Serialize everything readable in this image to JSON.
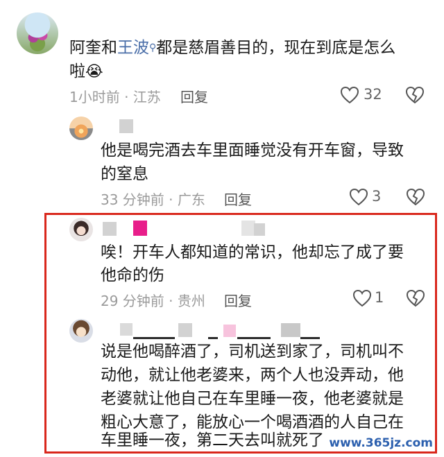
{
  "comments": [
    {
      "text_lines": [
        "阿奎和",
        "王波",
        "都是慈眉善目的，现在到底是怎么",
        "啦"
      ],
      "emoji": "😭",
      "meta": "1小时前 · 江苏",
      "reply": "回复",
      "likes": "32"
    },
    {
      "text_lines": [
        "他是喝完酒去车里面睡觉没有开车窗，导致",
        "的窒息"
      ],
      "meta": "33 分钟前 · 广东",
      "reply": "回复",
      "likes": "3"
    },
    {
      "text_lines": [
        "唉！开车人都知道的常识，他却忘了成了要",
        "他命的伤"
      ],
      "meta": "29 分钟前 · 贵州",
      "reply": "回复",
      "likes": "1"
    },
    {
      "text_lines": [
        "说是他喝醉酒了，司机送到家了，司机叫不",
        "动他，就让他老婆来，两个人也没弄动，他",
        "老婆就让他自己在车里睡一夜，他老婆就是",
        "粗心大意了，能放心一个喝酒酒的人自己在",
        "车里睡一夜，第二天去叫就死了"
      ]
    }
  ],
  "watermark": "www.365jz.com",
  "colors": {
    "highlight": "#d9271c",
    "link": "#4a6ea8",
    "pink": "#e81e8a"
  }
}
